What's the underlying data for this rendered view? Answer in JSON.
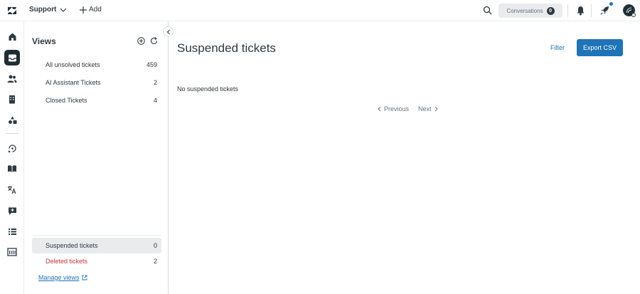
{
  "topbar": {
    "product": "Support",
    "add_label": "Add",
    "conversations_label": "Conversations",
    "conversations_count": "0"
  },
  "rail": {
    "icons": [
      "home-icon",
      "tickets-icon",
      "customers-icon",
      "organizations-icon",
      "objects-icon",
      "explore-icon",
      "knowledge-icon",
      "translate-icon",
      "feedback-icon",
      "reporting-icon",
      "admin-icon"
    ]
  },
  "views": {
    "title": "Views",
    "items": [
      {
        "label": "All unsolved tickets",
        "count": "459"
      },
      {
        "label": "AI Assistant Tickets",
        "count": "2"
      },
      {
        "label": "Closed Tickets",
        "count": "4"
      }
    ],
    "suspended": {
      "label": "Suspended tickets",
      "count": "0"
    },
    "deleted": {
      "label": "Deleted tickets",
      "count": "2"
    },
    "manage_label": "Manage views"
  },
  "main": {
    "title": "Suspended tickets",
    "filter_label": "Filter",
    "export_label": "Export CSV",
    "empty_message": "No suspended tickets",
    "previous_label": "Previous",
    "next_label": "Next"
  },
  "colors": {
    "accent": "#1f73b7",
    "danger": "#cc3340",
    "dark": "#1f2d35"
  }
}
